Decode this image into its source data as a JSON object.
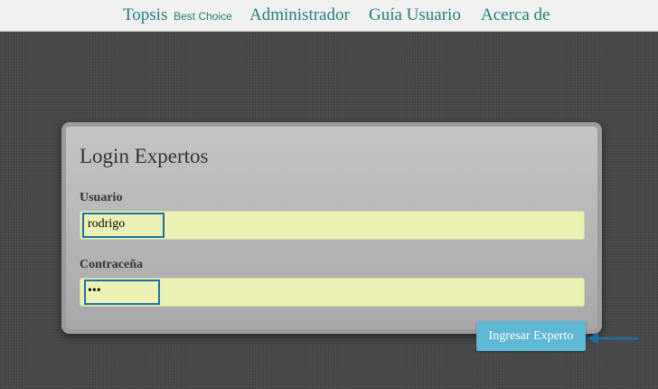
{
  "nav": {
    "brand": "Topsis",
    "brand_sub": "Best Choice",
    "admin": "Administrador",
    "guide": "Guía Usuario",
    "about": "Acerca de"
  },
  "login": {
    "title": "Login Expertos",
    "user_label": "Usuario",
    "user_value": "rodrigo",
    "password_label": "Contraceña",
    "password_value": "•••",
    "submit_label": "Ingresar Experto"
  },
  "colors": {
    "nav_text": "#1f7e78",
    "input_bg": "#ecf2b3",
    "button_bg": "#5fb8d4",
    "highlight": "#1b6fa3"
  }
}
